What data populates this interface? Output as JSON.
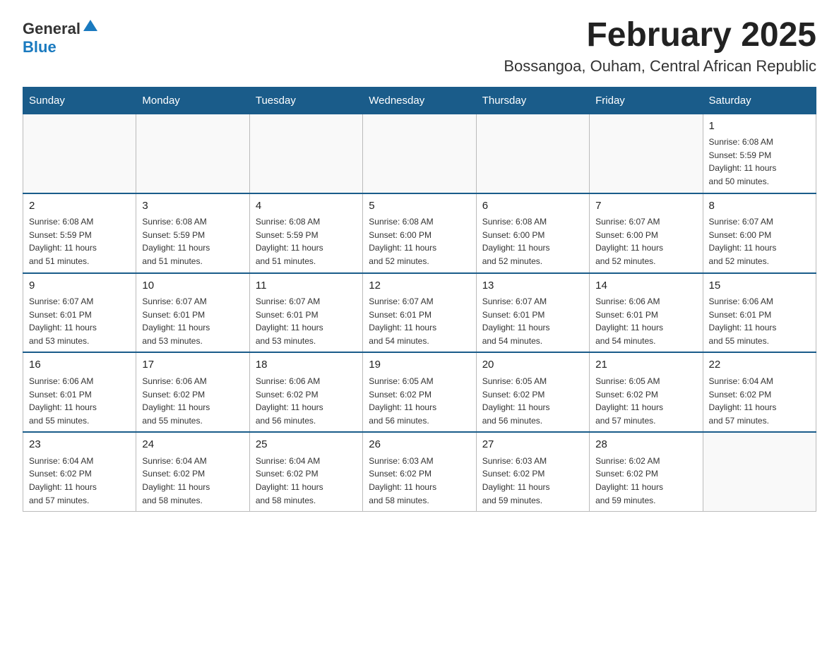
{
  "logo": {
    "text_general": "General",
    "text_blue": "Blue"
  },
  "title": "February 2025",
  "subtitle": "Bossangoa, Ouham, Central African Republic",
  "days_of_week": [
    "Sunday",
    "Monday",
    "Tuesday",
    "Wednesday",
    "Thursday",
    "Friday",
    "Saturday"
  ],
  "weeks": [
    [
      {
        "day": "",
        "info": ""
      },
      {
        "day": "",
        "info": ""
      },
      {
        "day": "",
        "info": ""
      },
      {
        "day": "",
        "info": ""
      },
      {
        "day": "",
        "info": ""
      },
      {
        "day": "",
        "info": ""
      },
      {
        "day": "1",
        "info": "Sunrise: 6:08 AM\nSunset: 5:59 PM\nDaylight: 11 hours\nand 50 minutes."
      }
    ],
    [
      {
        "day": "2",
        "info": "Sunrise: 6:08 AM\nSunset: 5:59 PM\nDaylight: 11 hours\nand 51 minutes."
      },
      {
        "day": "3",
        "info": "Sunrise: 6:08 AM\nSunset: 5:59 PM\nDaylight: 11 hours\nand 51 minutes."
      },
      {
        "day": "4",
        "info": "Sunrise: 6:08 AM\nSunset: 5:59 PM\nDaylight: 11 hours\nand 51 minutes."
      },
      {
        "day": "5",
        "info": "Sunrise: 6:08 AM\nSunset: 6:00 PM\nDaylight: 11 hours\nand 52 minutes."
      },
      {
        "day": "6",
        "info": "Sunrise: 6:08 AM\nSunset: 6:00 PM\nDaylight: 11 hours\nand 52 minutes."
      },
      {
        "day": "7",
        "info": "Sunrise: 6:07 AM\nSunset: 6:00 PM\nDaylight: 11 hours\nand 52 minutes."
      },
      {
        "day": "8",
        "info": "Sunrise: 6:07 AM\nSunset: 6:00 PM\nDaylight: 11 hours\nand 52 minutes."
      }
    ],
    [
      {
        "day": "9",
        "info": "Sunrise: 6:07 AM\nSunset: 6:01 PM\nDaylight: 11 hours\nand 53 minutes."
      },
      {
        "day": "10",
        "info": "Sunrise: 6:07 AM\nSunset: 6:01 PM\nDaylight: 11 hours\nand 53 minutes."
      },
      {
        "day": "11",
        "info": "Sunrise: 6:07 AM\nSunset: 6:01 PM\nDaylight: 11 hours\nand 53 minutes."
      },
      {
        "day": "12",
        "info": "Sunrise: 6:07 AM\nSunset: 6:01 PM\nDaylight: 11 hours\nand 54 minutes."
      },
      {
        "day": "13",
        "info": "Sunrise: 6:07 AM\nSunset: 6:01 PM\nDaylight: 11 hours\nand 54 minutes."
      },
      {
        "day": "14",
        "info": "Sunrise: 6:06 AM\nSunset: 6:01 PM\nDaylight: 11 hours\nand 54 minutes."
      },
      {
        "day": "15",
        "info": "Sunrise: 6:06 AM\nSunset: 6:01 PM\nDaylight: 11 hours\nand 55 minutes."
      }
    ],
    [
      {
        "day": "16",
        "info": "Sunrise: 6:06 AM\nSunset: 6:01 PM\nDaylight: 11 hours\nand 55 minutes."
      },
      {
        "day": "17",
        "info": "Sunrise: 6:06 AM\nSunset: 6:02 PM\nDaylight: 11 hours\nand 55 minutes."
      },
      {
        "day": "18",
        "info": "Sunrise: 6:06 AM\nSunset: 6:02 PM\nDaylight: 11 hours\nand 56 minutes."
      },
      {
        "day": "19",
        "info": "Sunrise: 6:05 AM\nSunset: 6:02 PM\nDaylight: 11 hours\nand 56 minutes."
      },
      {
        "day": "20",
        "info": "Sunrise: 6:05 AM\nSunset: 6:02 PM\nDaylight: 11 hours\nand 56 minutes."
      },
      {
        "day": "21",
        "info": "Sunrise: 6:05 AM\nSunset: 6:02 PM\nDaylight: 11 hours\nand 57 minutes."
      },
      {
        "day": "22",
        "info": "Sunrise: 6:04 AM\nSunset: 6:02 PM\nDaylight: 11 hours\nand 57 minutes."
      }
    ],
    [
      {
        "day": "23",
        "info": "Sunrise: 6:04 AM\nSunset: 6:02 PM\nDaylight: 11 hours\nand 57 minutes."
      },
      {
        "day": "24",
        "info": "Sunrise: 6:04 AM\nSunset: 6:02 PM\nDaylight: 11 hours\nand 58 minutes."
      },
      {
        "day": "25",
        "info": "Sunrise: 6:04 AM\nSunset: 6:02 PM\nDaylight: 11 hours\nand 58 minutes."
      },
      {
        "day": "26",
        "info": "Sunrise: 6:03 AM\nSunset: 6:02 PM\nDaylight: 11 hours\nand 58 minutes."
      },
      {
        "day": "27",
        "info": "Sunrise: 6:03 AM\nSunset: 6:02 PM\nDaylight: 11 hours\nand 59 minutes."
      },
      {
        "day": "28",
        "info": "Sunrise: 6:02 AM\nSunset: 6:02 PM\nDaylight: 11 hours\nand 59 minutes."
      },
      {
        "day": "",
        "info": ""
      }
    ]
  ]
}
